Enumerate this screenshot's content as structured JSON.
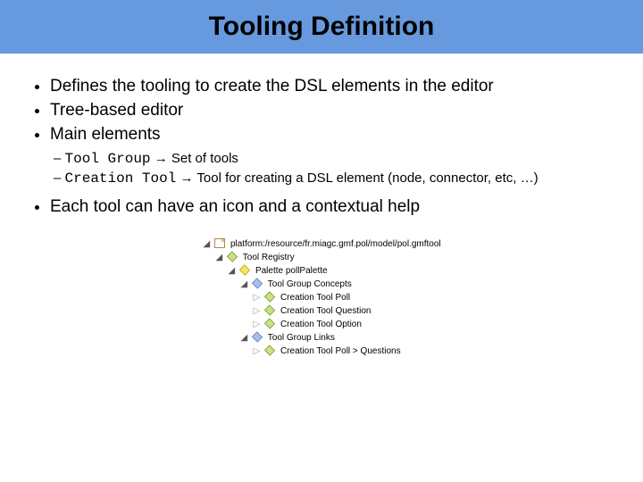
{
  "title": "Tooling Definition",
  "bullets": {
    "b1": "Defines the tooling to create the DSL elements in the editor",
    "b2": "Tree-based editor",
    "b3": "Main elements",
    "b4": "Each tool can have an icon and a contextual help"
  },
  "sub": {
    "s1_code": "Tool Group",
    "s1_arrow": "→",
    "s1_desc": "Set of tools",
    "s2_code": "Creation Tool",
    "s2_arrow": "→",
    "s2_desc": "Tool for creating a DSL element (node, connector, etc, …)"
  },
  "tree": {
    "t0": "platform:/resource/fr.miagc.gmf.pol/model/pol.gmftool",
    "t1": "Tool Registry",
    "t2": "Palette pollPalette",
    "t3": "Tool Group Concepts",
    "t4": "Creation Tool Poll",
    "t5": "Creation Tool Question",
    "t6": "Creation Tool Option",
    "t7": "Tool Group Links",
    "t8": "Creation Tool Poll > Questions"
  }
}
